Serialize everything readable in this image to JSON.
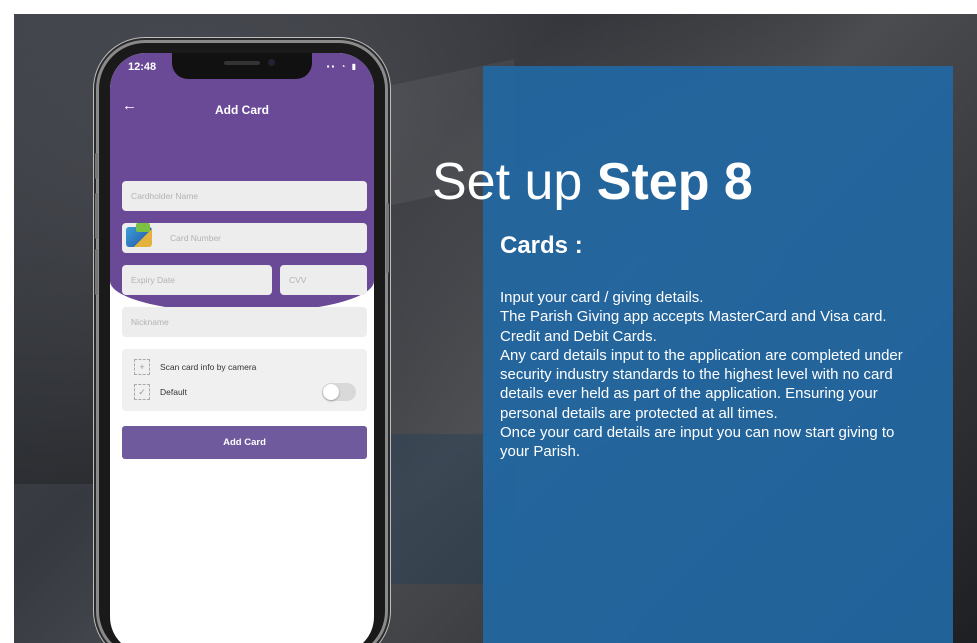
{
  "headline": {
    "prefix": "Set up ",
    "emphasis": "Step 8"
  },
  "section_title": "Cards :",
  "body_lines": [
    "Input your card / giving details.",
    "The Parish Giving app accepts MasterCard and Visa card. Credit and Debit Cards.",
    "Any card details input to the application are completed under security industry standards to the highest level with no card details ever held as part of the application. Ensuring your personal details are protected at all times.",
    "Once your card details are input you can now start giving to your Parish."
  ],
  "phone": {
    "status_time": "12:48",
    "status_icons": "▪▪ ◔ ▮",
    "back_icon": "←",
    "title": "Add Card",
    "fields": {
      "cardholder_placeholder": "Cardholder Name",
      "card_number_placeholder": "Card Number",
      "expiry_placeholder": "Expiry Date",
      "cvv_placeholder": "CVV",
      "nickname_placeholder": "Nickname"
    },
    "options": {
      "scan_label": "Scan card info by camera",
      "default_label": "Default",
      "default_on": false
    },
    "add_button": "Add Card"
  },
  "colors": {
    "panel": "#2167a3",
    "app_purple": "#6a4a96",
    "button": "#6e5a9c"
  }
}
